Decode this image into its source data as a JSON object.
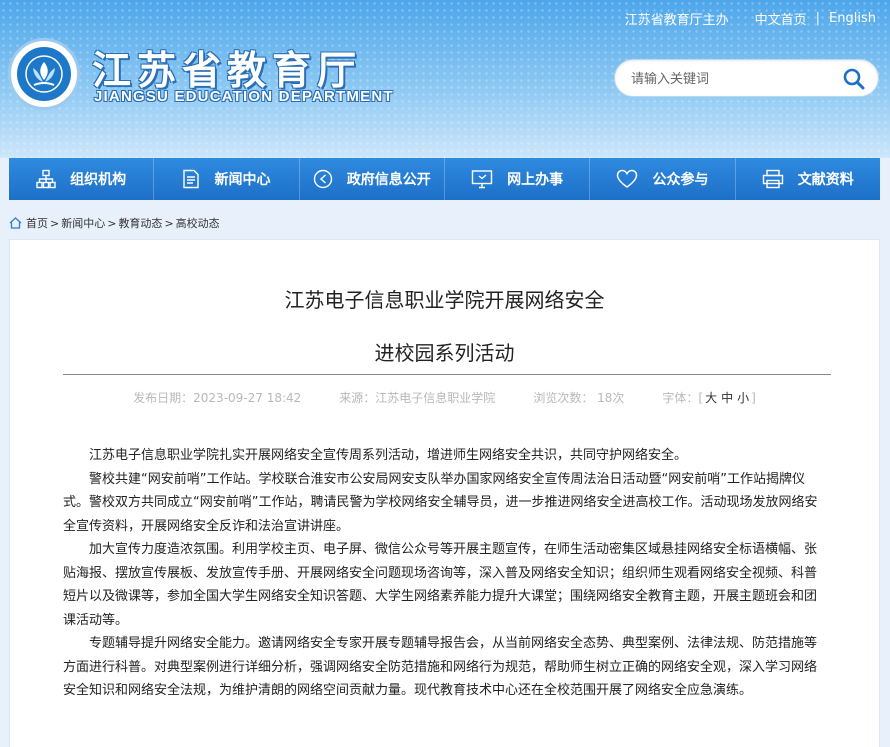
{
  "header": {
    "host": "江苏省教育厅主办",
    "home_cn": "中文首页",
    "english": "English",
    "logo_cn": "江苏省教育厅",
    "logo_en": "JIANGSU EDUCATION DEPARTMENT",
    "search_placeholder": "请输入关键词"
  },
  "nav": [
    {
      "label": "组织机构",
      "icon": "org-chart-icon"
    },
    {
      "label": "新闻中心",
      "icon": "document-icon"
    },
    {
      "label": "政府信息公开",
      "icon": "compass-icon"
    },
    {
      "label": "网上办事",
      "icon": "monitor-icon"
    },
    {
      "label": "公众参与",
      "icon": "heart-icon"
    },
    {
      "label": "文献资料",
      "icon": "printer-icon"
    }
  ],
  "breadcrumb": [
    "首页",
    "新闻中心",
    "教育动态",
    "高校动态"
  ],
  "article": {
    "title_line1": "江苏电子信息职业学院开展网络安全",
    "title_line2": "进校园系列活动",
    "publish": "发布日期：2023-09-27 18:42",
    "source": "来源：江苏电子信息职业学院",
    "views": "浏览次数：  18次",
    "font_label": "字体：[",
    "font_large": "大",
    "font_medium": "中",
    "font_small": "小",
    "font_end": "]",
    "paragraphs": [
      "江苏电子信息职业学院扎实开展网络安全宣传周系列活动，增进师生网络安全共识，共同守护网络安全。",
      "警校共建“网安前哨”工作站。学校联合淮安市公安局网安支队举办国家网络安全宣传周法治日活动暨“网安前哨”工作站揭牌仪式。警校双方共同成立“网安前哨”工作站，聘请民警为学校网络安全辅导员，进一步推进网络安全进高校工作。活动现场发放网络安全宣传资料，开展网络安全反诈和法治宣讲讲座。",
      "加大宣传力度造浓氛围。利用学校主页、电子屏、微信公众号等开展主题宣传，在师生活动密集区域悬挂网络安全标语横幅、张贴海报、摆放宣传展板、发放宣传手册、开展网络安全问题现场咨询等，深入普及网络安全知识；组织师生观看网络安全视频、科普短片以及微课等，参加全国大学生网络安全知识答题、大学生网络素养能力提升大课堂；围绕网络安全教育主题，开展主题班会和团课活动等。",
      "专题辅导提升网络安全能力。邀请网络安全专家开展专题辅导报告会，从当前网络安全态势、典型案例、法律法规、防范措施等方面进行科普。对典型案例进行详细分析，强调网络安全防范措施和网络行为规范，帮助师生树立正确的网络安全观，深入学习网络安全知识和网络安全法规，为维护清朗的网络空间贡献力量。现代教育技术中心还在全校范围开展了网络安全应急演练。"
    ]
  },
  "colors": {
    "nav_blue": "#1d6fc7",
    "header_blue": "#4da6ea"
  }
}
